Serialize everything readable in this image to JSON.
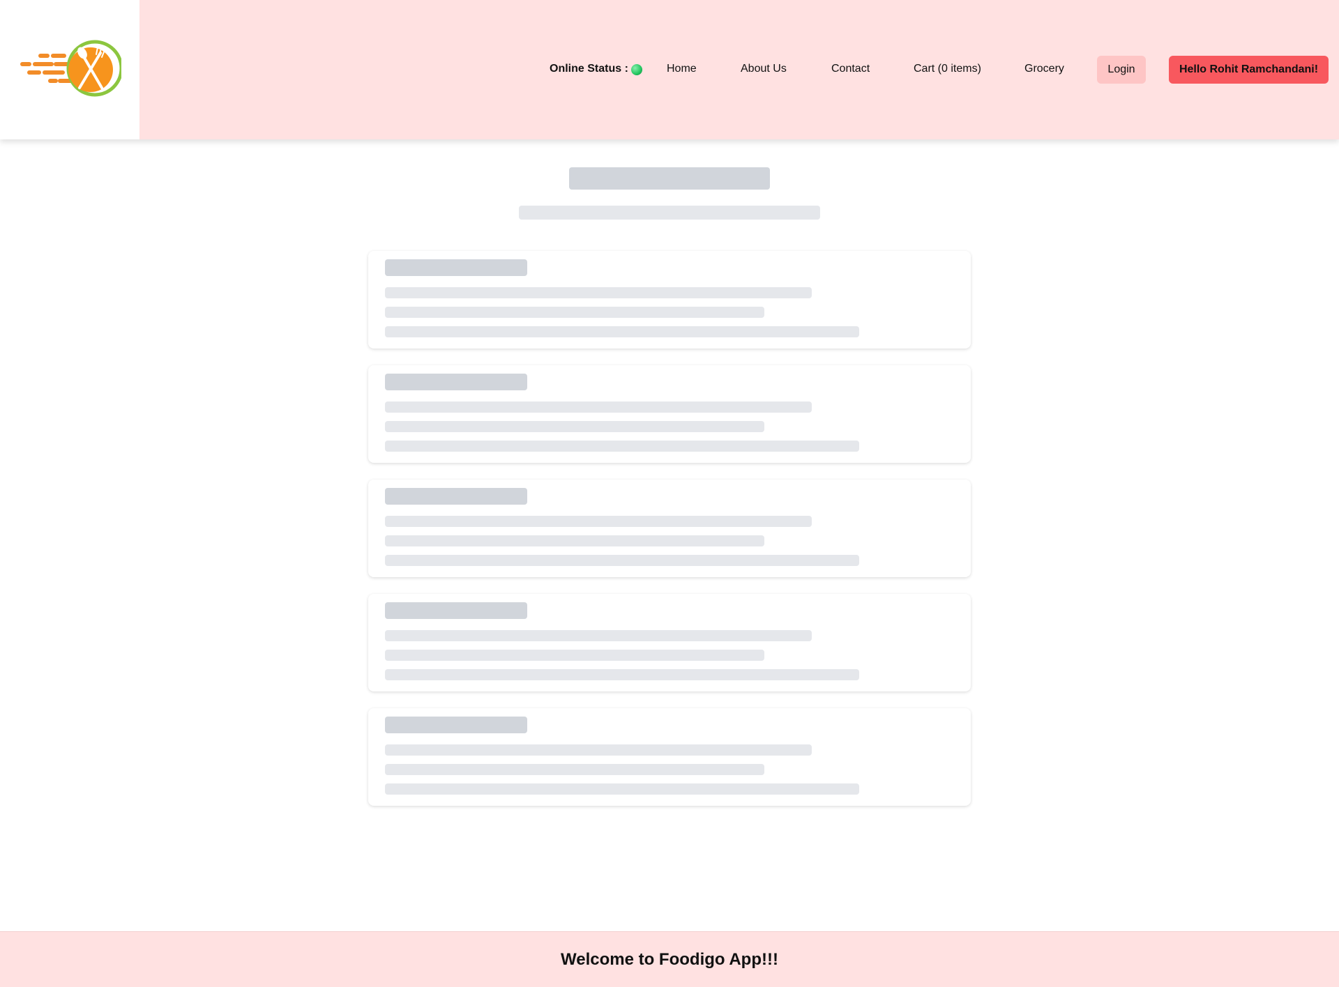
{
  "header": {
    "logo_icon": "foodigo-logo-icon",
    "online_status_label": "Online Status :",
    "status_indicator_color": "#22c55e",
    "nav": {
      "home": "Home",
      "about": "About Us",
      "contact": "Contact",
      "cart": "Cart (0 items)",
      "grocery": "Grocery"
    },
    "login_label": "Login",
    "greeting_label": "Hello Rohit Ramchandani!"
  },
  "colors": {
    "header_bg": "#ffe1e1",
    "login_bg": "#fec5c5",
    "greeting_bg": "#f8585e",
    "skeleton_dark": "#d1d5db",
    "skeleton_light": "#e5e7eb"
  },
  "footer": {
    "text": "Welcome to Foodigo App!!!"
  }
}
